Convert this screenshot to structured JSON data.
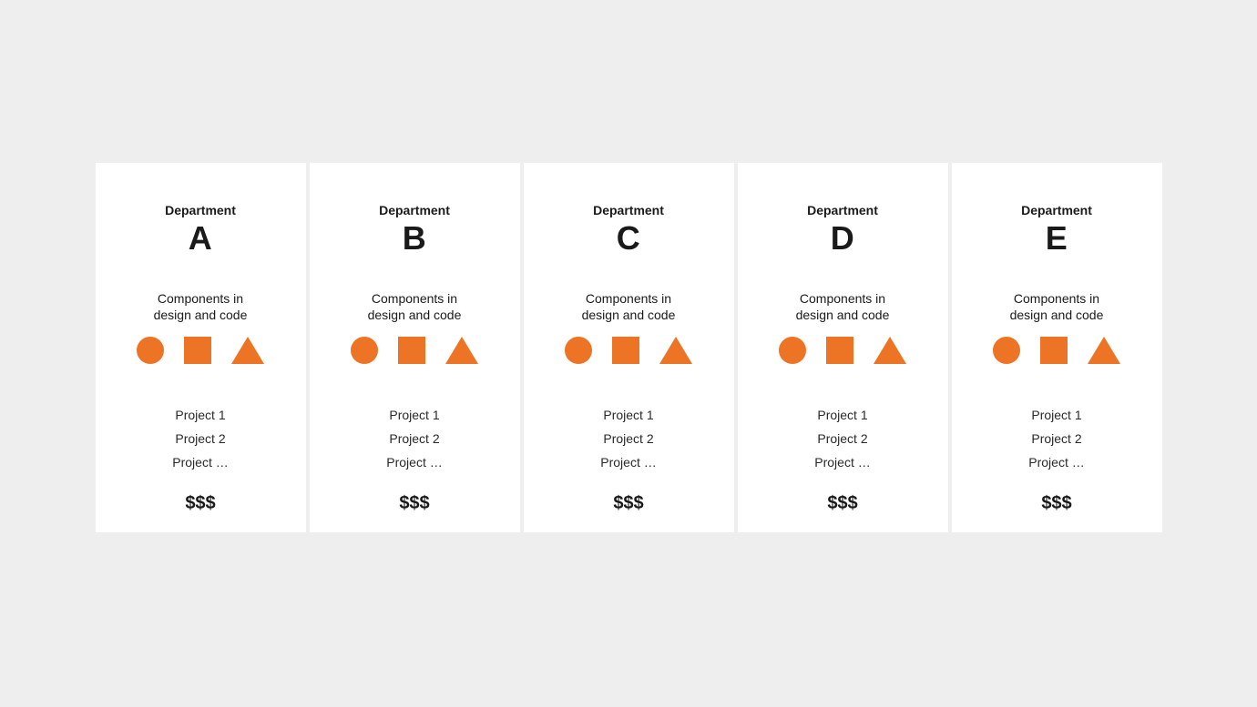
{
  "common": {
    "dept_label": "Department",
    "components_line1": "Components in",
    "components_line2": "design and code",
    "shapes": [
      "circle",
      "square",
      "triangle"
    ],
    "cost": "$$$",
    "shape_color": "#ed7424"
  },
  "departments": [
    {
      "letter": "A",
      "projects": [
        "Project 1",
        "Project 2",
        "Project …"
      ]
    },
    {
      "letter": "B",
      "projects": [
        "Project 1",
        "Project 2",
        "Project …"
      ]
    },
    {
      "letter": "C",
      "projects": [
        "Project 1",
        "Project 2",
        "Project …"
      ]
    },
    {
      "letter": "D",
      "projects": [
        "Project 1",
        "Project 2",
        "Project …"
      ]
    },
    {
      "letter": "E",
      "projects": [
        "Project 1",
        "Project 2",
        "Project …"
      ]
    }
  ]
}
